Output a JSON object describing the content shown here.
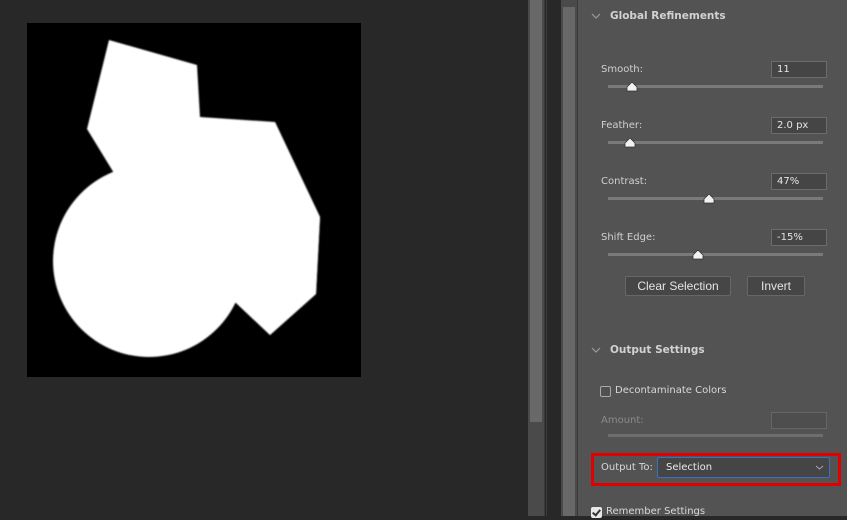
{
  "panel": {
    "global_refinements": {
      "title": "Global Refinements",
      "sliders": [
        {
          "label": "Smooth:",
          "value": "11",
          "position_pct": 11
        },
        {
          "label": "Feather:",
          "value": "2.0 px",
          "position_pct": 10
        },
        {
          "label": "Contrast:",
          "value": "47%",
          "position_pct": 47
        },
        {
          "label": "Shift Edge:",
          "value": "-15%",
          "position_pct": 42
        }
      ],
      "clear_selection_label": "Clear Selection",
      "invert_label": "Invert"
    },
    "output_settings": {
      "title": "Output Settings",
      "decontaminate_label": "Decontaminate Colors",
      "decontaminate_checked": false,
      "amount_label": "Amount:",
      "amount_value": "",
      "output_to_label": "Output To:",
      "output_to_value": "Selection",
      "remember_label": "Remember Settings",
      "remember_checked": true
    }
  },
  "colors": {
    "panel_bg": "#535353",
    "canvas_bg": "#282828",
    "highlight": "#e00000",
    "focus_border": "#3a6fc4"
  },
  "icons": {
    "section_chevron": "chevron-down-icon",
    "select_chevron": "chevron-down-icon",
    "slider_thumb": "slider-thumb-icon"
  }
}
